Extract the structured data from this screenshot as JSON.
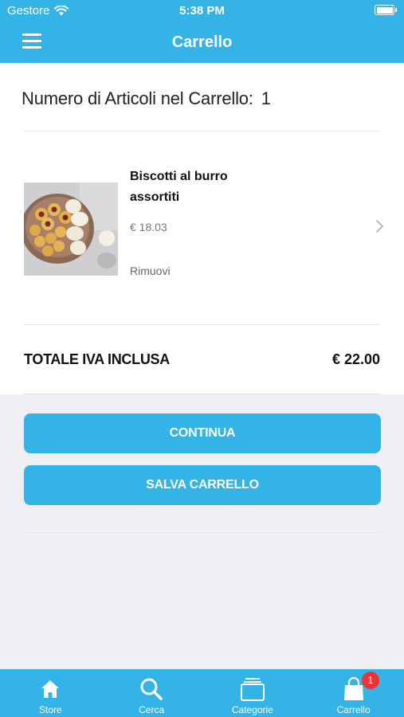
{
  "status_bar": {
    "carrier": "Gestore",
    "time": "5:38 PM"
  },
  "header": {
    "title": "Carrello"
  },
  "cart": {
    "count_label": "Numero di Articoli nel Carrello:",
    "count": "1",
    "items": [
      {
        "name": "Biscotti al burro assortiti",
        "price": "€ 18.03",
        "remove_label": "Rimuovi"
      }
    ],
    "total_label": "TOTALE IVA INCLUSA",
    "total_value": "€ 22.00"
  },
  "actions": {
    "continue_label": "CONTINUA",
    "save_label": "SALVA CARRELLO"
  },
  "tabbar": {
    "tabs": [
      {
        "label": "Store",
        "icon": "home-icon"
      },
      {
        "label": "Cerca",
        "icon": "search-icon"
      },
      {
        "label": "Categorie",
        "icon": "categories-icon"
      },
      {
        "label": "Carrello",
        "icon": "shopping-bag-icon"
      }
    ],
    "cart_badge": "1"
  },
  "colors": {
    "accent": "#34b3e6",
    "badge": "#ee3333",
    "background": "#efeff4"
  }
}
